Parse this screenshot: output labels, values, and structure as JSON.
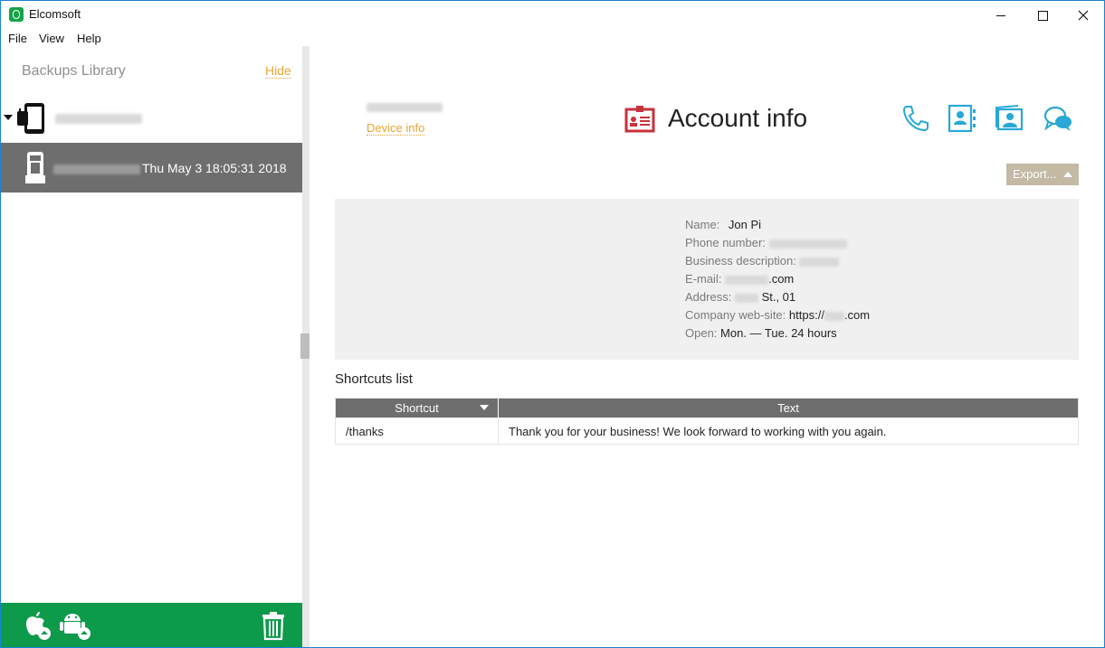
{
  "window": {
    "title": "Elcomsoft"
  },
  "menu": {
    "items": [
      "File",
      "View",
      "Help"
    ]
  },
  "sidebar": {
    "title": "Backups Library",
    "hide_label": "Hide",
    "backup": {
      "date": "Thu May 3 18:05:31 2018"
    }
  },
  "header": {
    "device_info_label": "Device info",
    "title": "Account info",
    "export_label": "Export..."
  },
  "account": {
    "name_label": "Name:",
    "name_value": "Jon Pi",
    "phone_label": "Phone number:",
    "business_label": "Business description:",
    "email_label": "E-mail:",
    "email_suffix": ".com",
    "address_label": "Address:",
    "address_suffix": "St., 01",
    "website_label": "Company web-site:",
    "website_prefix": "https://",
    "website_suffix": ".com",
    "open_label": "Open:",
    "open_value": "Mon. — Tue. 24 hours"
  },
  "shortcuts": {
    "title": "Shortcuts list",
    "columns": [
      "Shortcut",
      "Text"
    ],
    "rows": [
      {
        "shortcut": "/thanks",
        "text": "Thank you for your business! We look forward to working with you again."
      }
    ]
  },
  "colors": {
    "accent_orange": "#e8a533",
    "brand_green": "#0d9a4a",
    "account_red": "#c8323c",
    "nav_blue": "#29a8d6"
  },
  "icons": [
    "phone-icon",
    "contacts-icon",
    "media-icon",
    "chat-icon",
    "apple-icon",
    "android-icon",
    "trash-icon"
  ]
}
